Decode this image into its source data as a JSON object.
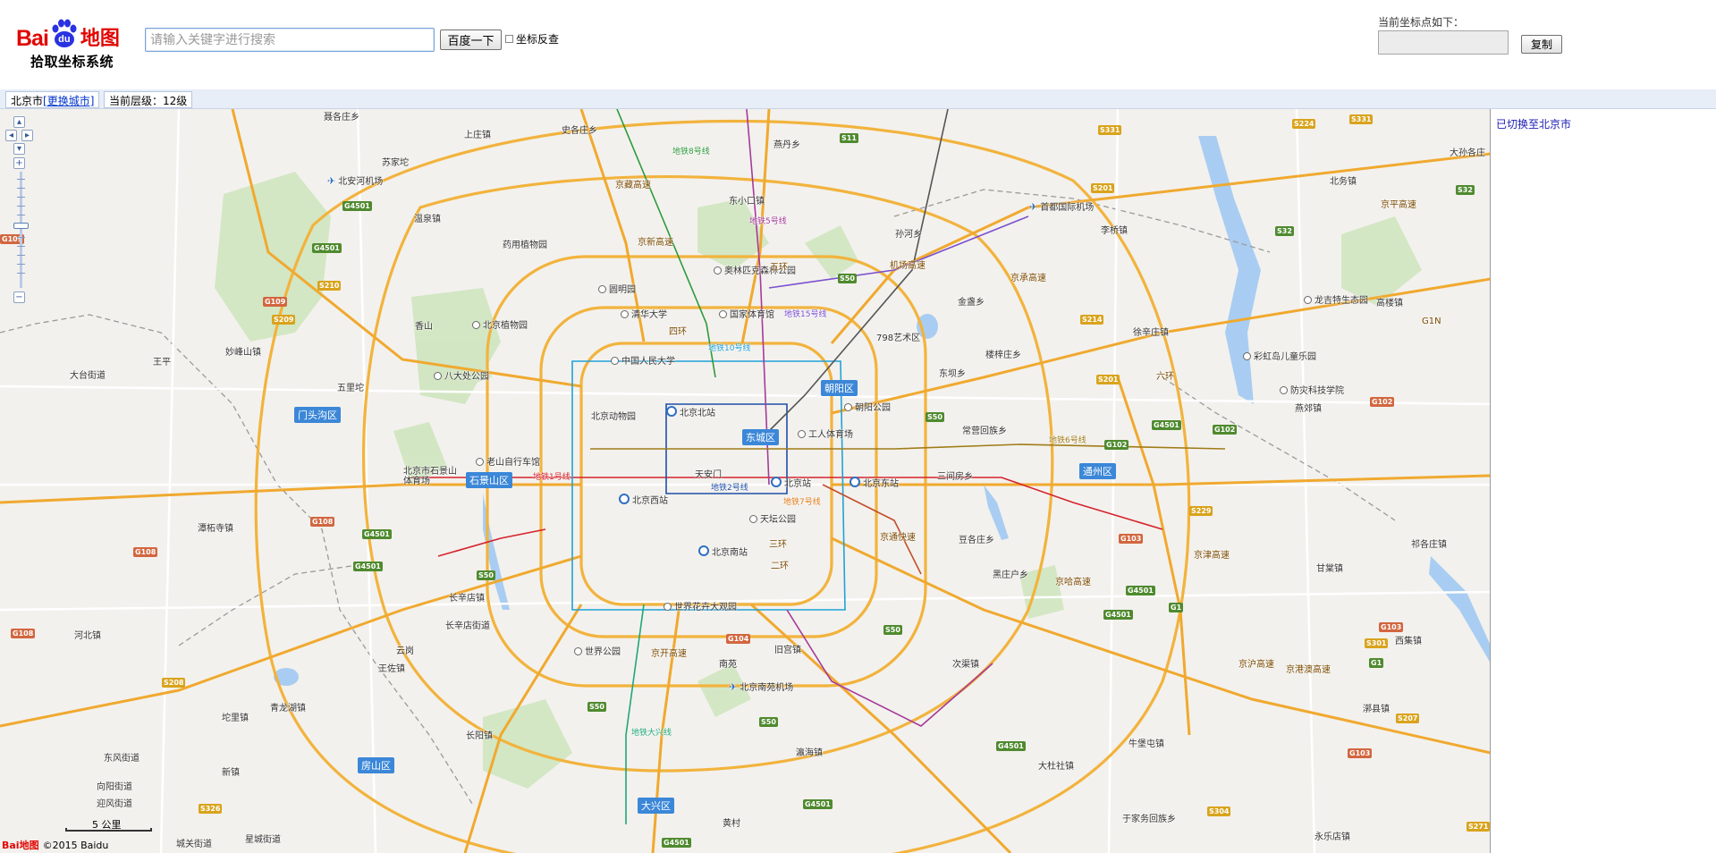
{
  "logo": {
    "bai": "Bai",
    "du": "du",
    "ditu": "地图",
    "subtitle": "拾取坐标系统"
  },
  "search": {
    "placeholder": "请输入关键字进行搜索",
    "button_label": "百度一下",
    "reverse_label": "坐标反查",
    "reverse_checked": false
  },
  "coordinates": {
    "label": "当前坐标点如下：",
    "value": "",
    "copy_label": "复制"
  },
  "info_bar": {
    "city": "北京市",
    "change_city": "[更换城市]",
    "zoom_level": "当前层级：12级"
  },
  "status": "已切换至北京市",
  "map": {
    "scale_label": "5 公里",
    "logo_text": "Bai地图",
    "copyright": "©2015 Baidu",
    "districts": [
      "门头沟区",
      "石景山区",
      "东城区",
      "朝阳区",
      "通州区",
      "房山区",
      "大兴区"
    ],
    "places": [
      "聂各庄乡",
      "上庄镇",
      "史各庄乡",
      "燕丹乡",
      "苏家坨",
      "北安河机场",
      "温泉镇",
      "东小口镇",
      "首都国际机场",
      "北务镇",
      "大孙各庄",
      "药用植物园",
      "奥林匹克森林公园",
      "孙河乡",
      "李桥镇",
      "圆明园",
      "清华大学",
      "国家体育馆",
      "金盏乡",
      "香山",
      "北京植物园",
      "妙峰山镇",
      "中国人民大学",
      "798艺术区",
      "徐辛庄镇",
      "龙吉特生态园",
      "高楼镇",
      "王平",
      "大台街道",
      "八大处公园",
      "东坝乡",
      "楼梓庄乡",
      "彩虹岛儿童乐园",
      "五里坨",
      "朝阳公园",
      "防灾科技学院",
      "燕郊镇",
      "北京动物园",
      "北京北站",
      "工人体育场",
      "常营回族乡",
      "老山自行车馆",
      "北京市石景山体育场",
      "天安门",
      "北京站",
      "北京东站",
      "三间房乡",
      "北京西站",
      "天坛公园",
      "豆各庄乡",
      "潭柘寺镇",
      "北京南站",
      "黑庄户乡",
      "祁各庄镇",
      "长辛店镇",
      "世界花卉大观园",
      "甘棠镇",
      "长辛店街道",
      "河北镇",
      "世界公园",
      "旧宫镇",
      "西集镇",
      "云岗",
      "王佐镇",
      "南苑",
      "瀛海镇",
      "次渠镇",
      "北京南苑机场",
      "青龙湖镇",
      "漷县镇",
      "坨里镇",
      "长阳镇",
      "牛堡屯镇",
      "东风街道",
      "新镇",
      "大杜社镇",
      "向阳街道",
      "迎风街道",
      "于家务回族乡",
      "永乐店镇",
      "星城街道",
      "城关街道",
      "黄村"
    ],
    "shields": [
      "G4501",
      "G4501",
      "G4501",
      "G4501",
      "G4501",
      "G4501",
      "G4501",
      "G4501",
      "G4501",
      "G4501",
      "S50",
      "S50",
      "S50",
      "S50",
      "S50",
      "S50",
      "S11",
      "S32",
      "S32",
      "S331",
      "S331",
      "S224",
      "S201",
      "S201",
      "S214",
      "S210",
      "S209",
      "G109",
      "G109",
      "G108",
      "G108",
      "G108",
      "G102",
      "G102",
      "G102",
      "G103",
      "G103",
      "G103",
      "G104",
      "S229",
      "S301",
      "G1",
      "G1",
      "S207",
      "S208",
      "S326",
      "S304",
      "S271"
    ],
    "road_labels": [
      "五环",
      "四环",
      "三环",
      "二环",
      "六环",
      "京承高速",
      "京平高速",
      "京哈高速",
      "京津高速",
      "京港澳高速",
      "京开高速",
      "京藏高速",
      "京新高速",
      "机场高速",
      "京沪高速",
      "京通快速",
      "G1N"
    ],
    "metro_labels": [
      "地铁1号线",
      "地铁2号线",
      "地铁5号线",
      "地铁10号线",
      "地铁15号线",
      "地铁6号线",
      "地铁8号线",
      "地铁7号线",
      "地铁大兴线"
    ]
  }
}
